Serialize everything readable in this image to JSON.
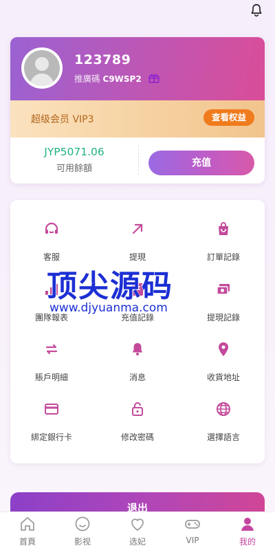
{
  "header": {
    "bell_icon": "bell-icon"
  },
  "profile": {
    "username": "123789",
    "referral_label": "推廣碼",
    "referral_code": "C9WSP2",
    "vip_label": "超级会员 VIP3",
    "vip_button": "查看权益",
    "balance_value": "JYP5071.06",
    "balance_label": "可用餘額",
    "recharge_button": "充值"
  },
  "menu": {
    "items": [
      {
        "label": "客服",
        "icon": "headset-icon"
      },
      {
        "label": "提現",
        "icon": "arrow-up-right-icon"
      },
      {
        "label": "訂單記錄",
        "icon": "shopping-bag-icon"
      },
      {
        "label": "團隊報表",
        "icon": "team-report-icon"
      },
      {
        "label": "充值記錄",
        "icon": "recharge-record-icon"
      },
      {
        "label": "提現記錄",
        "icon": "money-icon"
      },
      {
        "label": "賬戶明細",
        "icon": "swap-arrows-icon"
      },
      {
        "label": "消息",
        "icon": "bell-icon"
      },
      {
        "label": "收貨地址",
        "icon": "location-pin-icon"
      },
      {
        "label": "綁定銀行卡",
        "icon": "credit-card-icon"
      },
      {
        "label": "修改密碼",
        "icon": "lock-icon"
      },
      {
        "label": "選擇語言",
        "icon": "globe-icon"
      }
    ]
  },
  "watermark": {
    "title": "顶尖源码",
    "url": "www.djyuanma.com"
  },
  "logout_button": "退出",
  "tabbar": {
    "tabs": [
      {
        "label": "首頁",
        "icon": "home-icon"
      },
      {
        "label": "影视",
        "icon": "smile-icon"
      },
      {
        "label": "选妃",
        "icon": "heart-icon"
      },
      {
        "label": "VIP",
        "icon": "gamepad-icon"
      },
      {
        "label": "我的",
        "icon": "user-icon"
      }
    ],
    "active": "我的"
  },
  "colors": {
    "accent": "#c3459e",
    "balance": "#21b184",
    "vip_button": "#f07b1c",
    "vip_text": "#b2661b",
    "menu_icon": "#c34a9b"
  }
}
